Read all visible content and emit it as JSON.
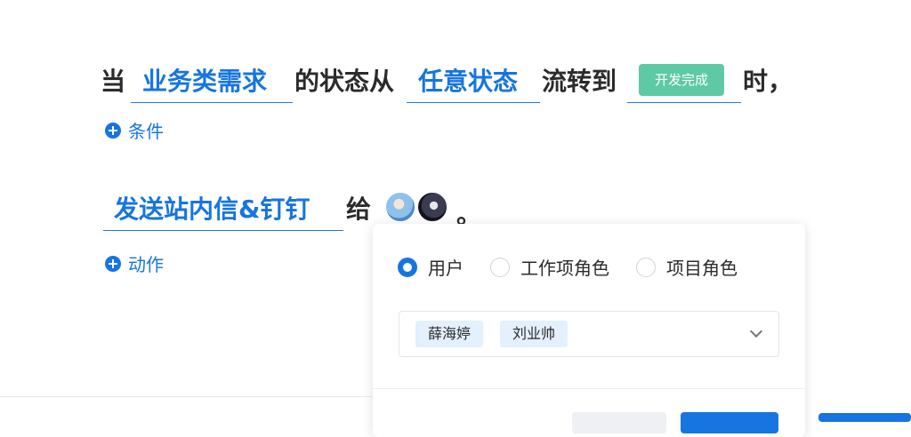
{
  "rule": {
    "when_word": "当",
    "work_item_type": "业务类需求",
    "status_from_text": "的状态从",
    "from_status": "任意状态",
    "flow_to_text": "流转到",
    "to_status_tag": "开发完成",
    "time_suffix": "时，",
    "add_condition": "条件",
    "action": "发送站内信&钉钉",
    "to_word": "给",
    "period": "。",
    "add_action": "动作"
  },
  "recipients": {
    "avatars": [
      "avatar-user-1",
      "avatar-user-2"
    ]
  },
  "popup": {
    "radio_options": [
      {
        "label": "用户",
        "checked": true
      },
      {
        "label": "工作项角色",
        "checked": false
      },
      {
        "label": "项目角色",
        "checked": false
      }
    ],
    "selected_users": [
      "薛海婷",
      "刘业帅"
    ]
  },
  "colors": {
    "accent": "#1675e0",
    "status_tag": "#5ecaa5",
    "chip_bg": "#e3f0fd"
  }
}
